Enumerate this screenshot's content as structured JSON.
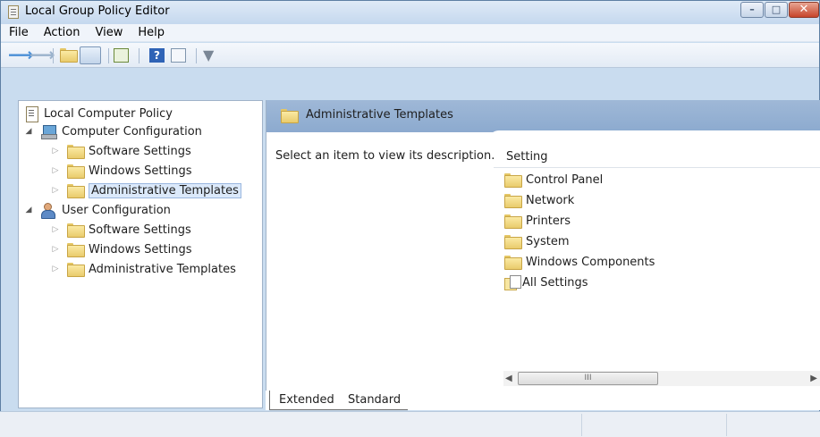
{
  "window": {
    "title": "Local Group Policy Editor"
  },
  "menu": [
    "File",
    "Action",
    "View",
    "Help"
  ],
  "toolbar": {
    "buttons": [
      "back-icon",
      "forward-icon",
      "up-folder-icon",
      "show-hide-tree-icon",
      "export-list-icon",
      "help-icon",
      "show-hide-action-pane-icon",
      "filter-icon"
    ]
  },
  "tree": {
    "root": "Local Computer Policy",
    "computer": {
      "label": "Computer Configuration",
      "children": [
        "Software Settings",
        "Windows Settings",
        "Administrative Templates"
      ]
    },
    "user": {
      "label": "User Configuration",
      "children": [
        "Software Settings",
        "Windows Settings",
        "Administrative Templates"
      ]
    },
    "selected": "Computer Configuration > Administrative Templates"
  },
  "details": {
    "header": "Administrative Templates",
    "description": "Select an item to view its description.",
    "column_header": "Setting",
    "items": [
      "Control Panel",
      "Network",
      "Printers",
      "System",
      "Windows Components",
      "All Settings"
    ],
    "scroll_thumb": "III"
  },
  "tabs": [
    "Extended",
    "Standard"
  ],
  "active_tab": "Extended"
}
